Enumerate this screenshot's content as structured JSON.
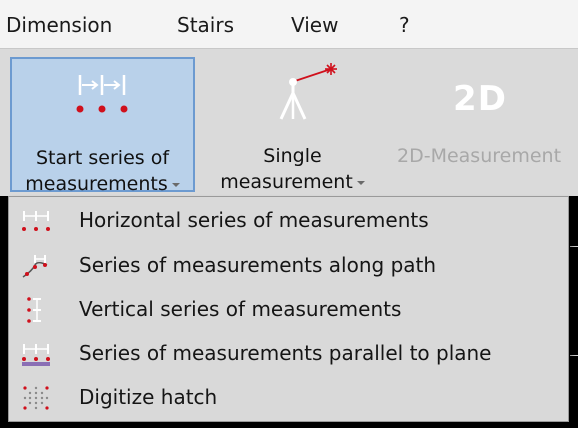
{
  "menubar": {
    "items": [
      {
        "label": "Dimension"
      },
      {
        "label": "Stairs"
      },
      {
        "label": "View"
      },
      {
        "label": "?"
      }
    ]
  },
  "ribbon": {
    "buttons": [
      {
        "line1": "Start series of",
        "line2": "measurements",
        "icon": "series-measurement-icon",
        "state": "selected",
        "has_dropdown": true
      },
      {
        "line1": "Single",
        "line2": "measurement",
        "icon": "tripod-laser-icon",
        "state": "normal",
        "has_dropdown": true
      },
      {
        "line1": "2D-Measurement",
        "big_text": "2D",
        "icon": "2d-text-icon",
        "state": "disabled"
      }
    ]
  },
  "dropdown": {
    "items": [
      {
        "label": "Horizontal series of measurements",
        "icon": "horizontal-series-icon"
      },
      {
        "label": "Series of measurements along path",
        "icon": "path-series-icon"
      },
      {
        "label": "Vertical series of measurements",
        "icon": "vertical-series-icon"
      },
      {
        "label": "Series of measurements parallel to plane",
        "icon": "parallel-plane-series-icon"
      },
      {
        "label": "Digitize hatch",
        "icon": "digitize-hatch-icon"
      }
    ]
  },
  "colors": {
    "accent_red": "#d0101c",
    "selected_bg": "#b9d1ea",
    "selected_border": "#6c9ad0",
    "ribbon_bg": "#dadada",
    "menu_bg": "#d9d9d9"
  }
}
